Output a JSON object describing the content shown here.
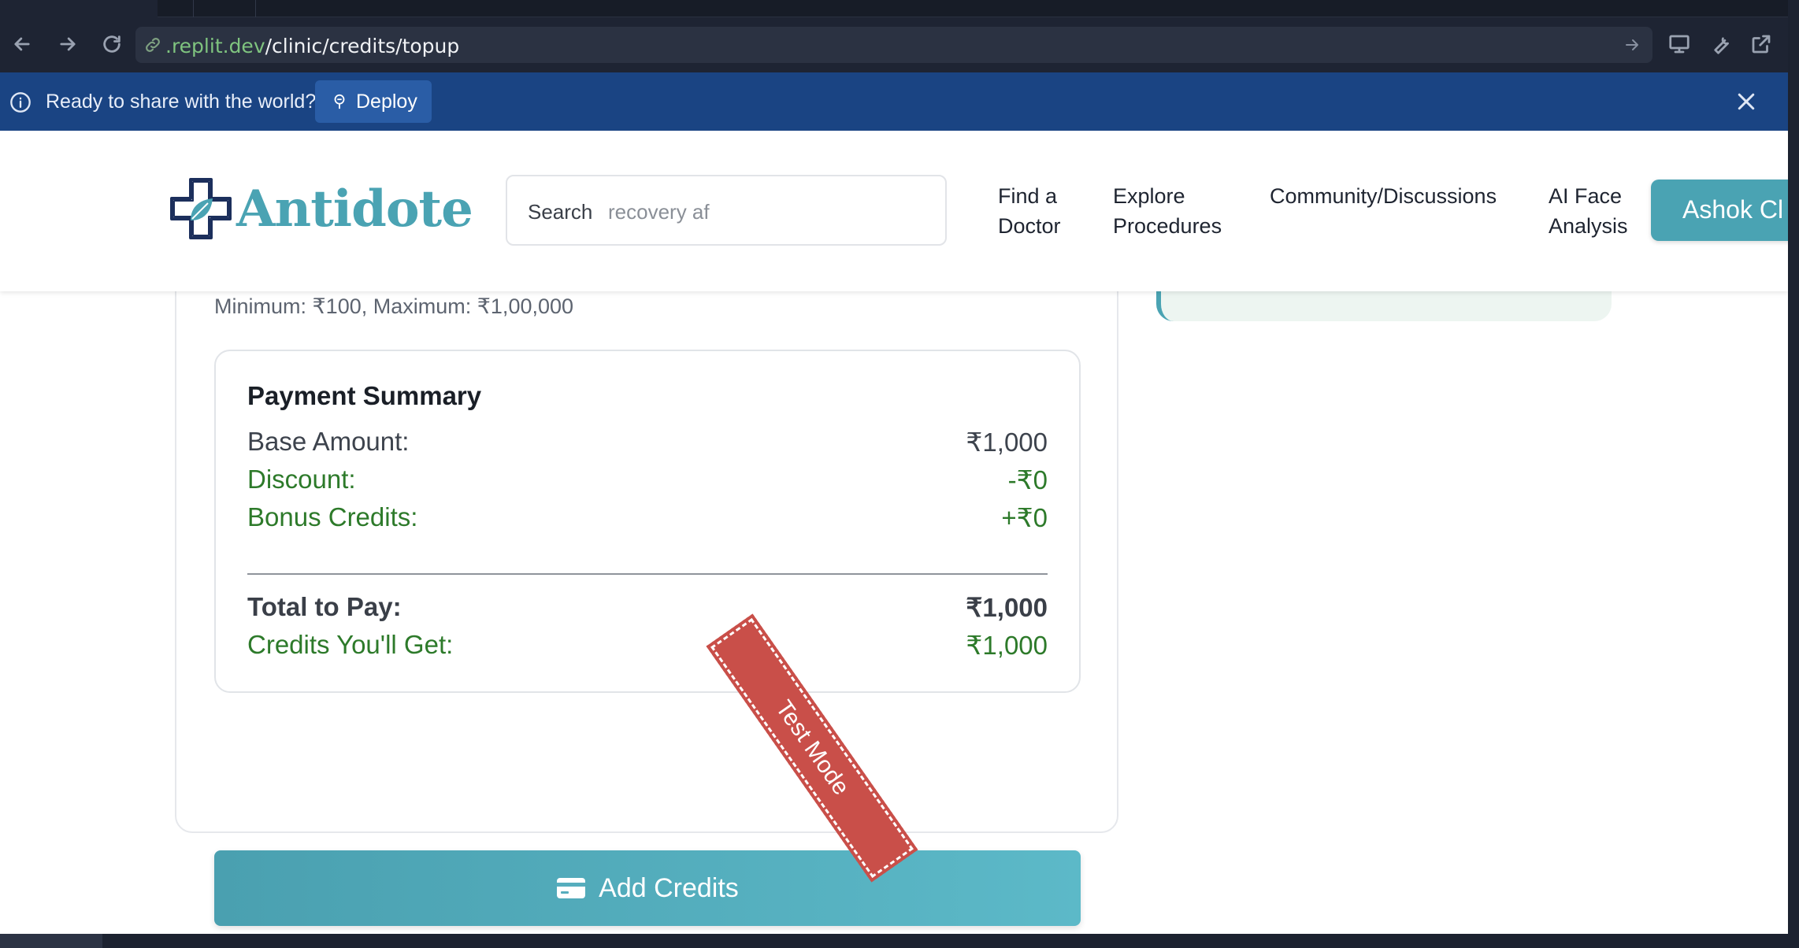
{
  "browser": {
    "url_host": ".replit.dev",
    "url_path": "/clinic/credits/topup"
  },
  "banner": {
    "message": "Ready to share with the world?",
    "deploy_label": "Deploy"
  },
  "header": {
    "brand": "Antidote",
    "search_label": "Search",
    "search_value": "recovery af",
    "nav": [
      {
        "line1": "Find a",
        "line2": "Doctor"
      },
      {
        "line1": "Explore",
        "line2": "Procedures"
      },
      {
        "line1": "Community/Discussions",
        "line2": ""
      },
      {
        "line1": "AI Face",
        "line2": "Analysis"
      }
    ],
    "cta_label": "Ashok Cl"
  },
  "topup": {
    "limits": "Minimum: ₹100, Maximum: ₹1,00,000"
  },
  "summary": {
    "title": "Payment Summary",
    "base_label": "Base Amount:",
    "base_value": "₹1,000",
    "discount_label": "Discount:",
    "discount_value": "-₹0",
    "bonus_label": "Bonus Credits:",
    "bonus_value": "+₹0",
    "total_label": "Total to Pay:",
    "total_value": "₹1,000",
    "credits_label": "Credits You'll Get:",
    "credits_value": "₹1,000"
  },
  "actions": {
    "add_credits_label": "Add Credits"
  },
  "ribbon": {
    "label": "Test Mode"
  },
  "colors": {
    "brand_teal": "#4aa3b3",
    "green_text": "#2d7a2a",
    "ribbon_red": "#c94f49",
    "banner_blue": "#1a4483"
  }
}
